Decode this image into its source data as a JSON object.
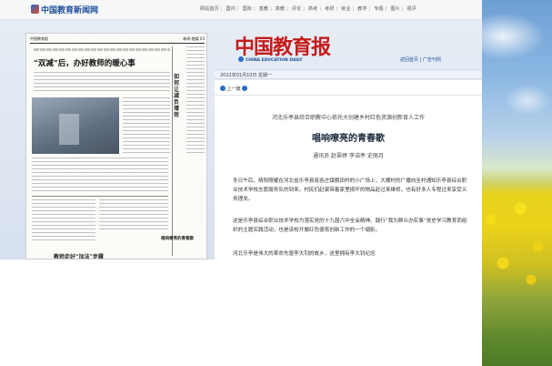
{
  "header": {
    "site_logo": "中国教育新闻网",
    "nav": [
      "网站首页",
      "国内",
      "国际",
      "基教",
      "高教",
      "评论",
      "高考",
      "考研",
      "就业",
      "教学",
      "专题",
      "图片",
      "视评"
    ]
  },
  "newspaper": {
    "masthead_left": "中国教育报",
    "masthead_right": "新闻·融媒 03",
    "headline": "“双减”后，办好教师的暖心事",
    "side_title": "如何让减负增效",
    "sub_headings": [
      "唱响嘹亮的青春歌",
      "教师走好“加法”步履"
    ]
  },
  "brand": {
    "name": "中国教育报",
    "english": "CHINA EDUCATION DAILY",
    "links": "返回首页 | 广告刊例"
  },
  "datebar": {
    "date": "2022年01月10日 星期一"
  },
  "article": {
    "nav_label": "上一篇",
    "kicker": "河北乐亭县综合职教中心依托大创建乡村红色资源创新育人工作",
    "title": "唱响嘹亮的青春歌",
    "authors": "通讯员 赵翠婷 李诘亭 史丽月",
    "paragraphs": [
      "冬日午后，晴阳照耀在河北省乐亭县庞各庄镇鹦田村的小广场上，大棚村的广播向全村通知乐亭县综合职业技术学校志愿服务队的到来。村民们赶紧带着家里损坏的物品赶过来维修，也有好多人专程过来享受义务理发。",
      "这是乐亭县综合职业技术学校为落实党的十九届六中全会精神、践行“我为群众办实事”党史学习教育而组织的主题实践活动，也是该校开展红色德育创新工作的一个缩影。",
      "河北乐亭是伟大的革命先驱李大钊的故乡，这里拥有李大钊纪念"
    ]
  }
}
